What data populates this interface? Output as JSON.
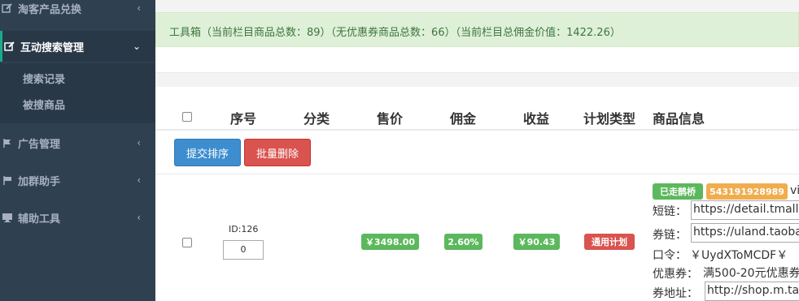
{
  "sidebar": {
    "items": [
      {
        "label": "淘客产品兑换",
        "icon": "edit-icon"
      },
      {
        "label": "互动搜索管理",
        "icon": "edit-icon"
      },
      {
        "label": "广告管理",
        "icon": "sign-icon"
      },
      {
        "label": "加群助手",
        "icon": "flag-icon"
      },
      {
        "label": "辅助工具",
        "icon": "desktop-icon"
      }
    ],
    "sub_items": [
      "搜索记录",
      "被搜商品"
    ],
    "active_index": 1
  },
  "alert": {
    "text": "工具箱（当前栏目商品总数：89）（无优惠券商品总数：66）（当前栏目总佣金价值：1422.26）"
  },
  "table": {
    "headers": [
      "序号",
      "分类",
      "售价",
      "佣金",
      "收益",
      "计划类型",
      "商品信息"
    ],
    "buttons": {
      "submit_sort": "提交排序",
      "batch_delete": "批量删除"
    },
    "rows": [
      {
        "id_label": "ID:126",
        "sort_value": "0",
        "price": "￥3498.00",
        "commission": "2.60%",
        "income": "￥90.43",
        "plan_type": "通用计划",
        "tags": {
          "bridge": "已走鹊桥",
          "item_id": "543191928989",
          "extra": "vi"
        },
        "short_link_label": "短链：",
        "short_link_value": "https://detail.tmall.c",
        "coupon_link_label": "券链：",
        "coupon_link_value": "https://uland.taobao",
        "token_label": "口令：",
        "token_value": "￥UydXToMCDF￥",
        "coupon_label": "优惠券：",
        "coupon_value": "满500-20元优惠券",
        "coupon_addr_label": "券地址：",
        "coupon_addr_value": "http://shop.m.taob"
      }
    ]
  },
  "colors": {
    "sidebar_bg": "#2f4050",
    "alert_bg": "#dff0d8",
    "green": "#5cb85c",
    "red": "#d9534f",
    "orange": "#f0ad4e",
    "blue": "#3e8ecf"
  }
}
